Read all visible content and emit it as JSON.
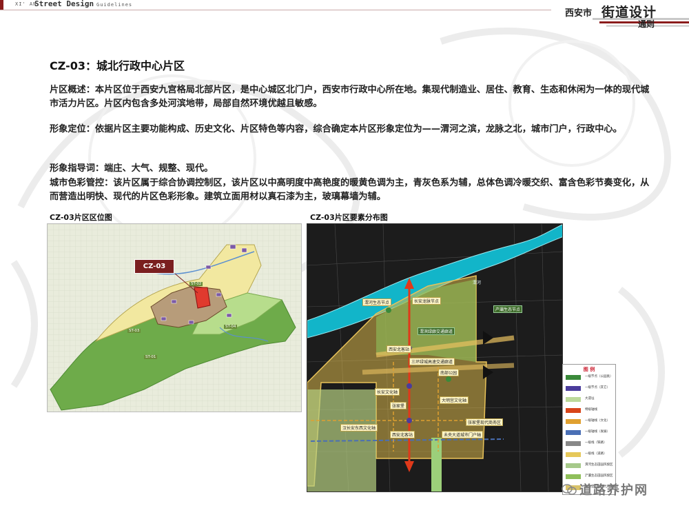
{
  "header": {
    "small_left": "XI' AN",
    "main": "Street Design",
    "guide": "Guidelines",
    "brand_city": "西安市",
    "brand_title": "街道设计",
    "brand_sub": "通则"
  },
  "section": {
    "title": "CZ-03：城北行政中心片区"
  },
  "paragraphs": {
    "overview": "片区概述：本片区位于西安九宫格局北部片区，是中心城区北门户，西安市行政中心所在地。集现代制造业、居住、教育、生态和休闲为一体的现代城市活力片区。片区内包含多处河滨地带，局部自然环境优越且敏感。",
    "image_position": "形象定位：依据片区主要功能构成、历史文化、片区特色等内容，综合确定本片区形象定位为——渭河之滨，龙脉之北，城市门户，行政中心。",
    "guide_words": "形象指导词：端庄、大气、规整、现代。",
    "color_control": "城市色彩管控：该片区属于综合协调控制区，该片区以中高明度中高艳度的暖黄色调为主，青灰色系为辅，总体色调冷暖交织、富含色彩节奏变化，从而营造出明快、现代的片区色彩形象。建筑立面用材以真石漆为主，玻璃幕墙为辅。"
  },
  "maps": {
    "left_caption": "CZ-03片区区位图",
    "right_caption": "CZ-03片区要素分布图",
    "left_tag": "CZ-03",
    "left_zones": [
      "ST-02",
      "ST-03",
      "ST-04",
      "ST-01"
    ],
    "right_callouts": {
      "a": "渭河生态节点",
      "b": "长安龙脉节点",
      "c": "渭滨绿廊交通廊道",
      "d": "西安北客站",
      "e": "三环绿城高速交通廊道",
      "f": "南部公园",
      "g": "汉长安东西文化轴",
      "h": "西安北客站",
      "i": "未央大道城市门户轴",
      "j": "张家堡现代商务区",
      "k": "大明宫文化轴",
      "l": "长安文化轴",
      "m": "张家堡",
      "n": "产灞生态节点"
    },
    "river_label": "渭河"
  },
  "legend": {
    "title": "图 例",
    "items": [
      {
        "label": "一级节点（公园类）",
        "color": "#3a8a3a"
      },
      {
        "label": "一级节点（其它）",
        "color": "#4b3c9c"
      },
      {
        "label": "大遗址",
        "color": "#bcd99a"
      },
      {
        "label": "特级轴线",
        "color": "#d8451a"
      },
      {
        "label": "一级轴线（文化）",
        "color": "#e0a030"
      },
      {
        "label": "一级轴线（发展）",
        "color": "#4a6fb5"
      },
      {
        "label": "一级线（铁路）",
        "color": "#888888"
      },
      {
        "label": "一级线（道路）",
        "color": "#e6c85a"
      },
      {
        "label": "渭河生态田园风貌区",
        "color": "#a6c98a"
      },
      {
        "label": "浐灞生态田园风貌区",
        "color": "#8fbf5a"
      },
      {
        "label": "张家堡综合现代风貌区",
        "color": "#d9c36a"
      }
    ]
  },
  "watermark": {
    "text": "道路养护网"
  }
}
